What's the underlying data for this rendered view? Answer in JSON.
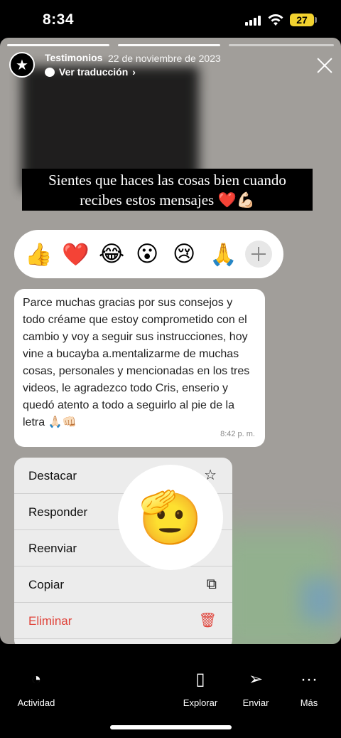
{
  "status_bar": {
    "time": "8:34",
    "battery_level": "27",
    "icons": [
      "cellular-signal-icon",
      "wifi-icon",
      "battery-icon"
    ]
  },
  "story": {
    "account_name": "Testimonios",
    "date": "22 de noviembre de 2023",
    "translate_label": "Ver traducción",
    "translate_chevron": "›",
    "avatar_glyph": "★",
    "progress_segments": [
      {
        "done": true
      },
      {
        "done": true
      },
      {
        "done": false
      }
    ],
    "caption_line1": "Sientes que haces las cosas bien cuando",
    "caption_line2": "recibes estos mensajes ❤️💪🏻"
  },
  "reactions": [
    "👍",
    "❤️",
    "😂",
    "😮",
    "😢",
    "🙏"
  ],
  "message": {
    "text": "Parce muchas gracias por sus consejos y todo créame que estoy comprometido con el cambio y voy a seguir sus instrucciones, hoy vine a bucayba a.mentalizarme de muchas cosas, personales y mencionadas en los tres videos, le agradezco todo Cris, enserio y quedó atento a todo a seguirlo al pie de la letra 🙏🏻👊🏻",
    "time": "8:42 p. m."
  },
  "context_menu": {
    "items": [
      {
        "label": "Destacar",
        "icon_glyph": "☆",
        "icon": "star-icon",
        "danger": false
      },
      {
        "label": "Responder",
        "icon_glyph": "",
        "icon": "",
        "danger": false
      },
      {
        "label": "Reenviar",
        "icon_glyph": "",
        "icon": "",
        "danger": false
      },
      {
        "label": "Copiar",
        "icon_glyph": "⧉",
        "icon": "copy-icon",
        "danger": false
      },
      {
        "label": "Eliminar",
        "icon_glyph": "🗑",
        "icon": "trash-icon",
        "danger": true
      }
    ],
    "danger_color": "#e0443b"
  },
  "overlay_emoji": "🫡",
  "bottom_nav": {
    "activity": {
      "label": "Actividad",
      "glyph": "◔",
      "icon": "activity-icon"
    },
    "explore": {
      "label": "Explorar",
      "glyph": "▯",
      "icon": "explore-icon"
    },
    "send": {
      "label": "Enviar",
      "glyph": "➢",
      "icon": "send-icon"
    },
    "more": {
      "label": "Más",
      "glyph": "···",
      "icon": "more-icon"
    }
  }
}
